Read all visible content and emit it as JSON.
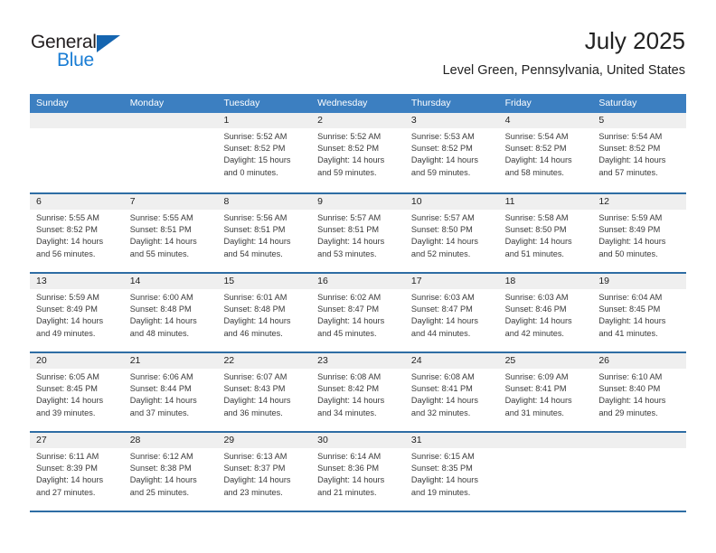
{
  "brand": {
    "name_top": "General",
    "name_bottom": "Blue",
    "accent_color": "#1a7dd4",
    "triangle_color": "#1565b0"
  },
  "header": {
    "title": "July 2025",
    "location": "Level Green, Pennsylvania, United States"
  },
  "calendar": {
    "header_bg": "#3c7fc1",
    "row_divider_color": "#2e6da4",
    "day_band_bg": "#efefef",
    "weekdays": [
      "Sunday",
      "Monday",
      "Tuesday",
      "Wednesday",
      "Thursday",
      "Friday",
      "Saturday"
    ],
    "weeks": [
      [
        {
          "day": "",
          "sunrise": "",
          "sunset": "",
          "daylight_line1": "",
          "daylight_line2": ""
        },
        {
          "day": "",
          "sunrise": "",
          "sunset": "",
          "daylight_line1": "",
          "daylight_line2": ""
        },
        {
          "day": "1",
          "sunrise": "Sunrise: 5:52 AM",
          "sunset": "Sunset: 8:52 PM",
          "daylight_line1": "Daylight: 15 hours",
          "daylight_line2": "and 0 minutes."
        },
        {
          "day": "2",
          "sunrise": "Sunrise: 5:52 AM",
          "sunset": "Sunset: 8:52 PM",
          "daylight_line1": "Daylight: 14 hours",
          "daylight_line2": "and 59 minutes."
        },
        {
          "day": "3",
          "sunrise": "Sunrise: 5:53 AM",
          "sunset": "Sunset: 8:52 PM",
          "daylight_line1": "Daylight: 14 hours",
          "daylight_line2": "and 59 minutes."
        },
        {
          "day": "4",
          "sunrise": "Sunrise: 5:54 AM",
          "sunset": "Sunset: 8:52 PM",
          "daylight_line1": "Daylight: 14 hours",
          "daylight_line2": "and 58 minutes."
        },
        {
          "day": "5",
          "sunrise": "Sunrise: 5:54 AM",
          "sunset": "Sunset: 8:52 PM",
          "daylight_line1": "Daylight: 14 hours",
          "daylight_line2": "and 57 minutes."
        }
      ],
      [
        {
          "day": "6",
          "sunrise": "Sunrise: 5:55 AM",
          "sunset": "Sunset: 8:52 PM",
          "daylight_line1": "Daylight: 14 hours",
          "daylight_line2": "and 56 minutes."
        },
        {
          "day": "7",
          "sunrise": "Sunrise: 5:55 AM",
          "sunset": "Sunset: 8:51 PM",
          "daylight_line1": "Daylight: 14 hours",
          "daylight_line2": "and 55 minutes."
        },
        {
          "day": "8",
          "sunrise": "Sunrise: 5:56 AM",
          "sunset": "Sunset: 8:51 PM",
          "daylight_line1": "Daylight: 14 hours",
          "daylight_line2": "and 54 minutes."
        },
        {
          "day": "9",
          "sunrise": "Sunrise: 5:57 AM",
          "sunset": "Sunset: 8:51 PM",
          "daylight_line1": "Daylight: 14 hours",
          "daylight_line2": "and 53 minutes."
        },
        {
          "day": "10",
          "sunrise": "Sunrise: 5:57 AM",
          "sunset": "Sunset: 8:50 PM",
          "daylight_line1": "Daylight: 14 hours",
          "daylight_line2": "and 52 minutes."
        },
        {
          "day": "11",
          "sunrise": "Sunrise: 5:58 AM",
          "sunset": "Sunset: 8:50 PM",
          "daylight_line1": "Daylight: 14 hours",
          "daylight_line2": "and 51 minutes."
        },
        {
          "day": "12",
          "sunrise": "Sunrise: 5:59 AM",
          "sunset": "Sunset: 8:49 PM",
          "daylight_line1": "Daylight: 14 hours",
          "daylight_line2": "and 50 minutes."
        }
      ],
      [
        {
          "day": "13",
          "sunrise": "Sunrise: 5:59 AM",
          "sunset": "Sunset: 8:49 PM",
          "daylight_line1": "Daylight: 14 hours",
          "daylight_line2": "and 49 minutes."
        },
        {
          "day": "14",
          "sunrise": "Sunrise: 6:00 AM",
          "sunset": "Sunset: 8:48 PM",
          "daylight_line1": "Daylight: 14 hours",
          "daylight_line2": "and 48 minutes."
        },
        {
          "day": "15",
          "sunrise": "Sunrise: 6:01 AM",
          "sunset": "Sunset: 8:48 PM",
          "daylight_line1": "Daylight: 14 hours",
          "daylight_line2": "and 46 minutes."
        },
        {
          "day": "16",
          "sunrise": "Sunrise: 6:02 AM",
          "sunset": "Sunset: 8:47 PM",
          "daylight_line1": "Daylight: 14 hours",
          "daylight_line2": "and 45 minutes."
        },
        {
          "day": "17",
          "sunrise": "Sunrise: 6:03 AM",
          "sunset": "Sunset: 8:47 PM",
          "daylight_line1": "Daylight: 14 hours",
          "daylight_line2": "and 44 minutes."
        },
        {
          "day": "18",
          "sunrise": "Sunrise: 6:03 AM",
          "sunset": "Sunset: 8:46 PM",
          "daylight_line1": "Daylight: 14 hours",
          "daylight_line2": "and 42 minutes."
        },
        {
          "day": "19",
          "sunrise": "Sunrise: 6:04 AM",
          "sunset": "Sunset: 8:45 PM",
          "daylight_line1": "Daylight: 14 hours",
          "daylight_line2": "and 41 minutes."
        }
      ],
      [
        {
          "day": "20",
          "sunrise": "Sunrise: 6:05 AM",
          "sunset": "Sunset: 8:45 PM",
          "daylight_line1": "Daylight: 14 hours",
          "daylight_line2": "and 39 minutes."
        },
        {
          "day": "21",
          "sunrise": "Sunrise: 6:06 AM",
          "sunset": "Sunset: 8:44 PM",
          "daylight_line1": "Daylight: 14 hours",
          "daylight_line2": "and 37 minutes."
        },
        {
          "day": "22",
          "sunrise": "Sunrise: 6:07 AM",
          "sunset": "Sunset: 8:43 PM",
          "daylight_line1": "Daylight: 14 hours",
          "daylight_line2": "and 36 minutes."
        },
        {
          "day": "23",
          "sunrise": "Sunrise: 6:08 AM",
          "sunset": "Sunset: 8:42 PM",
          "daylight_line1": "Daylight: 14 hours",
          "daylight_line2": "and 34 minutes."
        },
        {
          "day": "24",
          "sunrise": "Sunrise: 6:08 AM",
          "sunset": "Sunset: 8:41 PM",
          "daylight_line1": "Daylight: 14 hours",
          "daylight_line2": "and 32 minutes."
        },
        {
          "day": "25",
          "sunrise": "Sunrise: 6:09 AM",
          "sunset": "Sunset: 8:41 PM",
          "daylight_line1": "Daylight: 14 hours",
          "daylight_line2": "and 31 minutes."
        },
        {
          "day": "26",
          "sunrise": "Sunrise: 6:10 AM",
          "sunset": "Sunset: 8:40 PM",
          "daylight_line1": "Daylight: 14 hours",
          "daylight_line2": "and 29 minutes."
        }
      ],
      [
        {
          "day": "27",
          "sunrise": "Sunrise: 6:11 AM",
          "sunset": "Sunset: 8:39 PM",
          "daylight_line1": "Daylight: 14 hours",
          "daylight_line2": "and 27 minutes."
        },
        {
          "day": "28",
          "sunrise": "Sunrise: 6:12 AM",
          "sunset": "Sunset: 8:38 PM",
          "daylight_line1": "Daylight: 14 hours",
          "daylight_line2": "and 25 minutes."
        },
        {
          "day": "29",
          "sunrise": "Sunrise: 6:13 AM",
          "sunset": "Sunset: 8:37 PM",
          "daylight_line1": "Daylight: 14 hours",
          "daylight_line2": "and 23 minutes."
        },
        {
          "day": "30",
          "sunrise": "Sunrise: 6:14 AM",
          "sunset": "Sunset: 8:36 PM",
          "daylight_line1": "Daylight: 14 hours",
          "daylight_line2": "and 21 minutes."
        },
        {
          "day": "31",
          "sunrise": "Sunrise: 6:15 AM",
          "sunset": "Sunset: 8:35 PM",
          "daylight_line1": "Daylight: 14 hours",
          "daylight_line2": "and 19 minutes."
        },
        {
          "day": "",
          "sunrise": "",
          "sunset": "",
          "daylight_line1": "",
          "daylight_line2": ""
        },
        {
          "day": "",
          "sunrise": "",
          "sunset": "",
          "daylight_line1": "",
          "daylight_line2": ""
        }
      ]
    ]
  }
}
